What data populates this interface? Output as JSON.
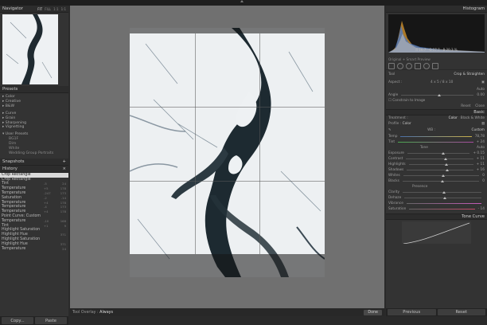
{
  "navigator": {
    "title": "Navigator",
    "tabs": [
      "FIT",
      "FILL",
      "1:1",
      "1:1"
    ]
  },
  "presets": {
    "title": "Presets",
    "groups": [
      "Color",
      "Creative",
      "B&W"
    ],
    "groups2": [
      "Curve",
      "Grain",
      "Sharpening",
      "Vignetting"
    ],
    "user_title": "User Presets",
    "user_items": [
      "BG1F",
      "Dim",
      "White",
      "Wedding Group Portraits"
    ]
  },
  "snapshots": {
    "title": "Snapshots"
  },
  "history": {
    "title": "History",
    "rows": [
      {
        "name": "Crop Rectangle",
        "a": "",
        "b": ""
      },
      {
        "name": "Crop Rectangle",
        "a": "",
        "b": ""
      },
      {
        "name": "Tint",
        "a": "-5",
        "b": "24"
      },
      {
        "name": "Temperature",
        "a": "+5",
        "b": "178"
      },
      {
        "name": "Temperature",
        "a": "-247",
        "b": "173"
      },
      {
        "name": "Saturation",
        "a": "-2",
        "b": "-14"
      },
      {
        "name": "Temperature",
        "a": "+4",
        "b": "178"
      },
      {
        "name": "Temperature",
        "a": "-4",
        "b": "173"
      },
      {
        "name": "Temperature",
        "a": "+4",
        "b": "178"
      },
      {
        "name": "Point Curve: Custom",
        "a": "",
        "b": ""
      },
      {
        "name": "Temperature",
        "a": "-10",
        "b": "168"
      },
      {
        "name": "Tint",
        "a": "+1",
        "b": "9"
      },
      {
        "name": "Highlight Saturation",
        "a": "",
        "b": ""
      },
      {
        "name": "Highlight Hue",
        "a": "",
        "b": "371"
      },
      {
        "name": "Highlight Saturation",
        "a": "",
        "b": ""
      },
      {
        "name": "Highlight Hue",
        "a": "",
        "b": "371"
      },
      {
        "name": "Temperature",
        "a": "",
        "b": "24"
      }
    ]
  },
  "left_buttons": {
    "copy": "Copy...",
    "paste": "Paste"
  },
  "toolbar": {
    "overlay_label": "Tool Overlay :",
    "overlay_value": "Always",
    "done": "Done"
  },
  "histogram": {
    "title": "Histogram",
    "values": [
      "R 16.7",
      "G 17.7",
      "B 20.3 %"
    ],
    "mode": "Original + Smart Preview"
  },
  "crop": {
    "tool_label": "Tool",
    "tool_value": "Crop & Straighten",
    "aspect_label": "Aspect :",
    "aspect_value": "4 x 5 / 8 x 10",
    "auto": "Auto",
    "angle_label": "Angle",
    "angle_value": "0.00",
    "constrain": "Constrain to Image",
    "reset": "Reset",
    "close": "Close"
  },
  "basic": {
    "title": "Basic",
    "treatment_label": "Treatment :",
    "color": "Color",
    "bw": "Black & White",
    "profile_label": "Profile :",
    "profile_value": "Color",
    "wb_label": "WB :",
    "wb_value": "Custom",
    "temp_label": "Temp",
    "temp_value": "78,78",
    "tint_label": "Tint",
    "tint_value": "+ 24",
    "tone_label": "Tone",
    "tone_auto": "Auto",
    "exposure_label": "Exposure",
    "exposure_value": "+ 0.15",
    "contrast_label": "Contrast",
    "contrast_value": "+ 11",
    "highlights_label": "Highlights",
    "highlights_value": "+ 11",
    "shadows_label": "Shadows",
    "shadows_value": "+ 16",
    "whites_label": "Whites",
    "whites_value": "0",
    "blacks_label": "Blacks",
    "blacks_value": "0",
    "presence_label": "Presence",
    "clarity_label": "Clarity",
    "dehaze_label": "Dehaze",
    "vibrance_label": "Vibrance",
    "saturation_label": "Saturation",
    "saturation_value": "- 14"
  },
  "tone_curve": {
    "title": "Tone Curve"
  },
  "right_buttons": {
    "previous": "Previous",
    "reset": "Reset"
  },
  "colors": {
    "accent": "#e0e0e0",
    "panel": "#333333",
    "canvas": "#707070"
  }
}
